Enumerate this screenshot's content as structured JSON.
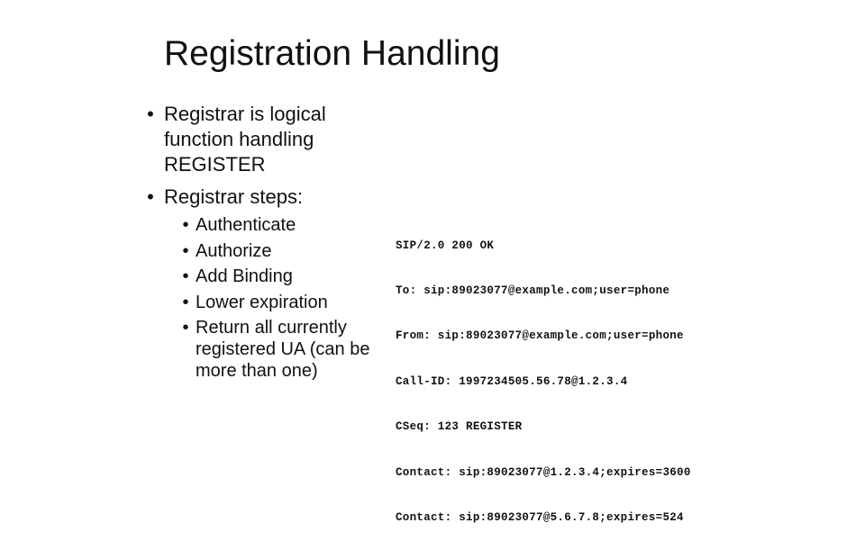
{
  "slide": {
    "title": "Registration Handling",
    "bullets": [
      {
        "text": "Registrar is logical function handling REGISTER"
      },
      {
        "text": "Registrar steps:"
      }
    ],
    "sub_bullets": [
      {
        "text": "Authenticate"
      },
      {
        "text": "Authorize"
      },
      {
        "text": "Add Binding"
      },
      {
        "text": "Lower expiration"
      },
      {
        "text": "Return all currently registered UA (can be more than one)"
      }
    ],
    "bullet_glyph": "•",
    "sip_message": [
      "SIP/2.0 200 OK",
      "To: sip:89023077@example.com;user=phone",
      "From: sip:89023077@example.com;user=phone",
      "Call-ID: 1997234505.56.78@1.2.3.4",
      "CSeq: 123 REGISTER",
      "Contact: sip:89023077@1.2.3.4;expires=3600",
      "Contact: sip:89023077@5.6.7.8;expires=524"
    ]
  }
}
